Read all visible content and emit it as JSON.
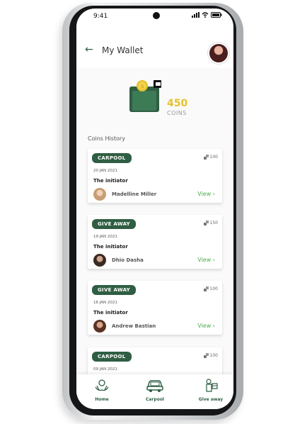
{
  "status": {
    "time": "9:41"
  },
  "header": {
    "back_icon": "arrow-left-icon",
    "title": "My Wallet"
  },
  "wallet": {
    "coins": "450",
    "coins_label": "COINS"
  },
  "history": {
    "title": "Coins History",
    "items": [
      {
        "category": "CARPOOL",
        "points": "100",
        "date": "20 JAN 2021",
        "label": "The initiator",
        "name": "Madelline Miller",
        "action": "View"
      },
      {
        "category": "GIVE AWAY",
        "points": "150",
        "date": "19 JAN 2021",
        "label": "The initiator",
        "name": "Dhio Dasha",
        "action": "View"
      },
      {
        "category": "GIVE AWAY",
        "points": "100",
        "date": "16 JAN 2021",
        "label": "The initiator",
        "name": "Andrew Bastian",
        "action": "View"
      },
      {
        "category": "CARPOOL",
        "points": "100",
        "date": "09 JAN 2021"
      }
    ]
  },
  "nav": {
    "home": "Home",
    "carpool": "Carpool",
    "giveaway": "Give away"
  },
  "colors": {
    "primary": "#2f5e43",
    "accent_coin": "#e8c129",
    "link": "#4caf50"
  }
}
